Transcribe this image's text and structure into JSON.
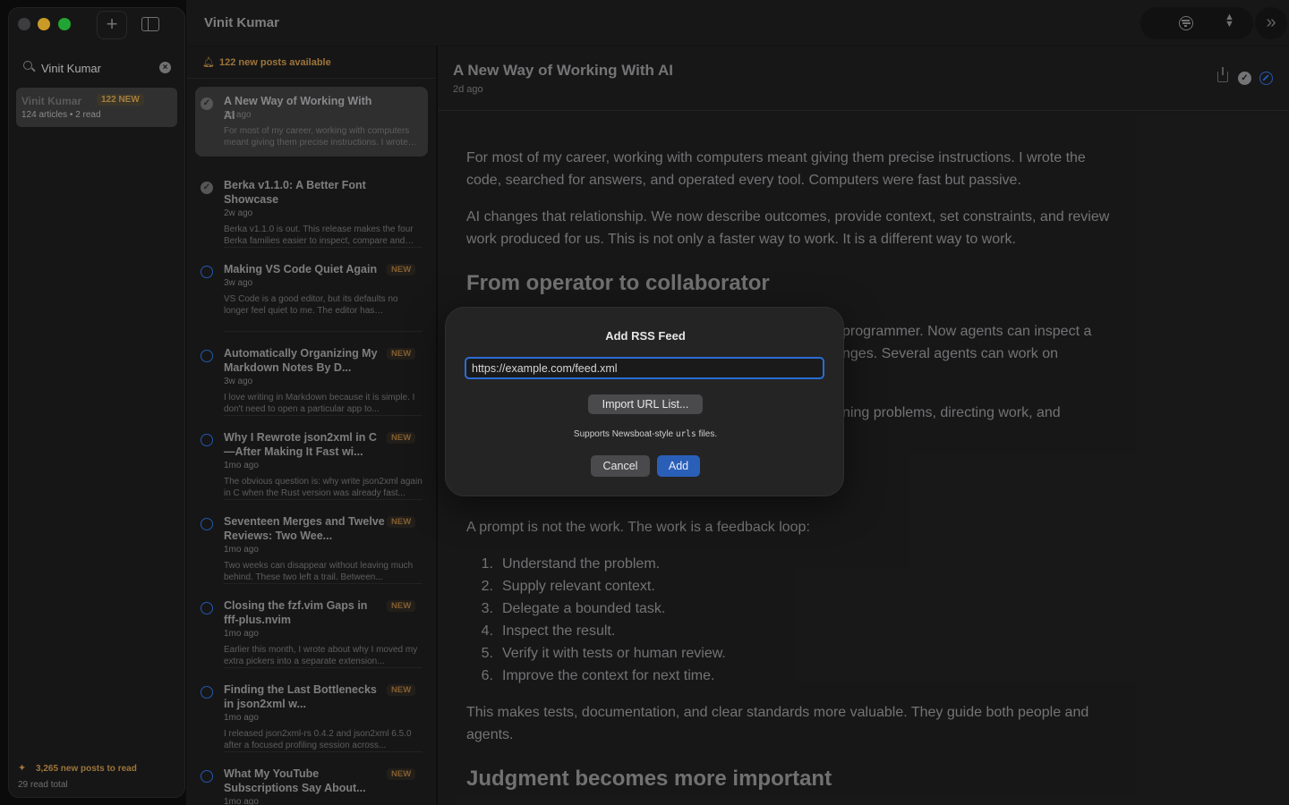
{
  "window": {
    "header_title": "Vinit Kumar"
  },
  "sidebar": {
    "search_value": "Vinit Kumar",
    "feed": {
      "name": "Vinit Kumar",
      "new_badge": "122 NEW",
      "meta": "124 articles • 2 read"
    },
    "footer": {
      "new_posts": "3,265 new posts to read",
      "read_total": "29 read total"
    }
  },
  "list": {
    "banner": "122 new posts available",
    "articles": [
      {
        "title": "A New Way of Working With AI",
        "date": "2d ago",
        "snippet": "For most of my career, working with computers meant giving them precise instructions. I wrote the code...",
        "status": "read",
        "badge": "",
        "selected": true
      },
      {
        "title": "Berka v1.1.0: A Better Font Showcase",
        "date": "2w ago",
        "snippet": "Berka v1.1.0 is out. This release makes the four Berka families easier to inspect, compare and use...",
        "status": "read",
        "badge": "",
        "selected": false
      },
      {
        "title": "Making VS Code Quiet Again",
        "date": "3w ago",
        "snippet": "VS Code is a good editor, but its defaults no longer feel quiet to me. The editor has accumulated...",
        "status": "unread",
        "badge": "NEW",
        "selected": false
      },
      {
        "title": "Automatically Organizing My Markdown Notes By D...",
        "date": "3w ago",
        "snippet": "I love writing in Markdown because it is simple. I don't need to open a particular app to...",
        "status": "unread",
        "badge": "NEW",
        "selected": false
      },
      {
        "title": "Why I Rewrote json2xml in C—After Making It Fast wi...",
        "date": "1mo ago",
        "snippet": "The obvious question is: why write json2xml again in C when the Rust version was already fast...",
        "status": "unread",
        "badge": "NEW",
        "selected": false
      },
      {
        "title": "Seventeen Merges and Twelve Reviews: Two Wee...",
        "date": "1mo ago",
        "snippet": "Two weeks can disappear without leaving much behind. These two left a trail. Between...",
        "status": "unread",
        "badge": "NEW",
        "selected": false
      },
      {
        "title": "Closing the fzf.vim Gaps in fff-plus.nvim",
        "date": "1mo ago",
        "snippet": "Earlier this month, I wrote about why I moved my extra  pickers into a separate extension...",
        "status": "unread",
        "badge": "NEW",
        "selected": false
      },
      {
        "title": "Finding the Last Bottlenecks in json2xml w...",
        "date": "1mo ago",
        "snippet": "I released json2xml-rs 0.4.2 and json2xml 6.5.0 after a focused profiling session across...",
        "status": "unread",
        "badge": "NEW",
        "selected": false
      },
      {
        "title": "What My YouTube Subscriptions Say About...",
        "date": "1mo ago",
        "snippet": "YouTube is the strangest bookshelf I own. It...",
        "status": "unread",
        "badge": "NEW",
        "selected": false
      }
    ]
  },
  "reader": {
    "title": "A New Way of Working With AI",
    "date": "2d ago",
    "body": {
      "p1": "For most of my career, working with computers meant giving them precise instructions. I wrote the code, searched for answers, and operated every tool. Computers were fast but passive.",
      "p2": "AI changes that relationship. We now describe outcomes, provide context, set constraints, and review work produced for us. This is not only a faster way to work. It is a different way to work.",
      "h1": "From operator to collaborator",
      "p3_line1": "programmer. Now agents can inspect a",
      "p3_line2": "nges. Several agents can work on",
      "p4_line1": "ning problems, directing work, and",
      "p5": "A prompt is not the work. The work is a feedback loop:",
      "steps": [
        "Understand the problem.",
        "Supply relevant context.",
        "Delegate a bounded task.",
        "Inspect the result.",
        "Verify it with tests or human review.",
        "Improve the context for next time."
      ],
      "p6": "This makes tests, documentation, and clear standards more valuable. They guide both people and agents.",
      "h2": "Judgment becomes more important"
    }
  },
  "dialog": {
    "title": "Add RSS Feed",
    "url_value": "https://example.com/feed.xml",
    "import_label": "Import URL List...",
    "hint_prefix": "Supports Newsboat-style",
    "hint_code": "urls",
    "hint_suffix": "files.",
    "cancel_label": "Cancel",
    "add_label": "Add"
  },
  "colors": {
    "accent_blue": "#2b6cd4",
    "new_orange": "#c08f46",
    "traffic_yellow": "#f6bd2f",
    "traffic_green": "#2ac940"
  }
}
